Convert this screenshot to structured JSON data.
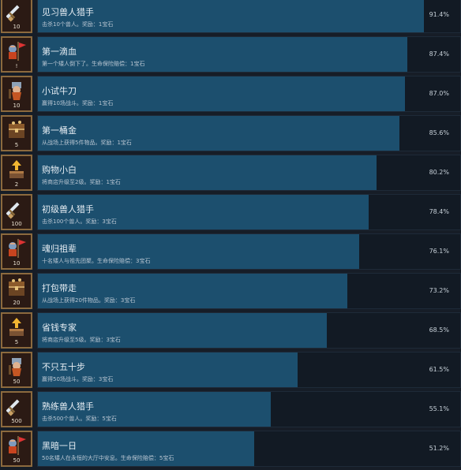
{
  "achievements": [
    {
      "title": "见习兽人猎手",
      "desc": "击杀10个兽人。奖励：1宝石",
      "percent": "91.4%",
      "count": "10",
      "icon": "sword-icon"
    },
    {
      "title": "第一滴血",
      "desc": "第一个矮人倒下了。生命保险赔偿：1宝石",
      "percent": "87.4%",
      "count": "!",
      "icon": "dwarf-flag-icon"
    },
    {
      "title": "小试牛刀",
      "desc": "赢得10场战斗。奖励：1宝石",
      "percent": "87.0%",
      "count": "10",
      "icon": "dwarf-warrior-icon"
    },
    {
      "title": "第一桶金",
      "desc": "从战场上获得5件物品。奖励：1宝石",
      "percent": "85.6%",
      "count": "5",
      "icon": "treasure-chest-icon"
    },
    {
      "title": "购物小白",
      "desc": "将商店升级至2级。奖励：1宝石",
      "percent": "80.2%",
      "count": "2",
      "icon": "shop-upgrade-icon"
    },
    {
      "title": "初级兽人猎手",
      "desc": "击杀100个兽人。奖励：3宝石",
      "percent": "78.4%",
      "count": "100",
      "icon": "sword-icon"
    },
    {
      "title": "魂归祖辈",
      "desc": "十名矮人与祖先团聚。生命保险赔偿：3宝石",
      "percent": "76.1%",
      "count": "10",
      "icon": "dwarf-flag-icon"
    },
    {
      "title": "打包带走",
      "desc": "从战场上获得20件物品。奖励：3宝石",
      "percent": "73.2%",
      "count": "20",
      "icon": "treasure-chest-icon"
    },
    {
      "title": "省钱专家",
      "desc": "将商店升级至5级。奖励：3宝石",
      "percent": "68.5%",
      "count": "5",
      "icon": "shop-upgrade-icon"
    },
    {
      "title": "不只五十步",
      "desc": "赢得50场战斗。奖励：3宝石",
      "percent": "61.5%",
      "count": "50",
      "icon": "dwarf-warrior-icon"
    },
    {
      "title": "熟练兽人猎手",
      "desc": "击杀500个兽人。奖励：5宝石",
      "percent": "55.1%",
      "count": "500",
      "icon": "sword-icon"
    },
    {
      "title": "黑暗一日",
      "desc": "50名矮人在永恒的大厅中安息。生命保险赔偿：5宝石",
      "percent": "51.2%",
      "count": "50",
      "icon": "dwarf-flag-icon"
    }
  ],
  "colors": {
    "page_bg": "#161d27",
    "bar_fill": "#1c4f6e",
    "bar_track": "#121a24",
    "icon_border": "#8c6a3e"
  }
}
